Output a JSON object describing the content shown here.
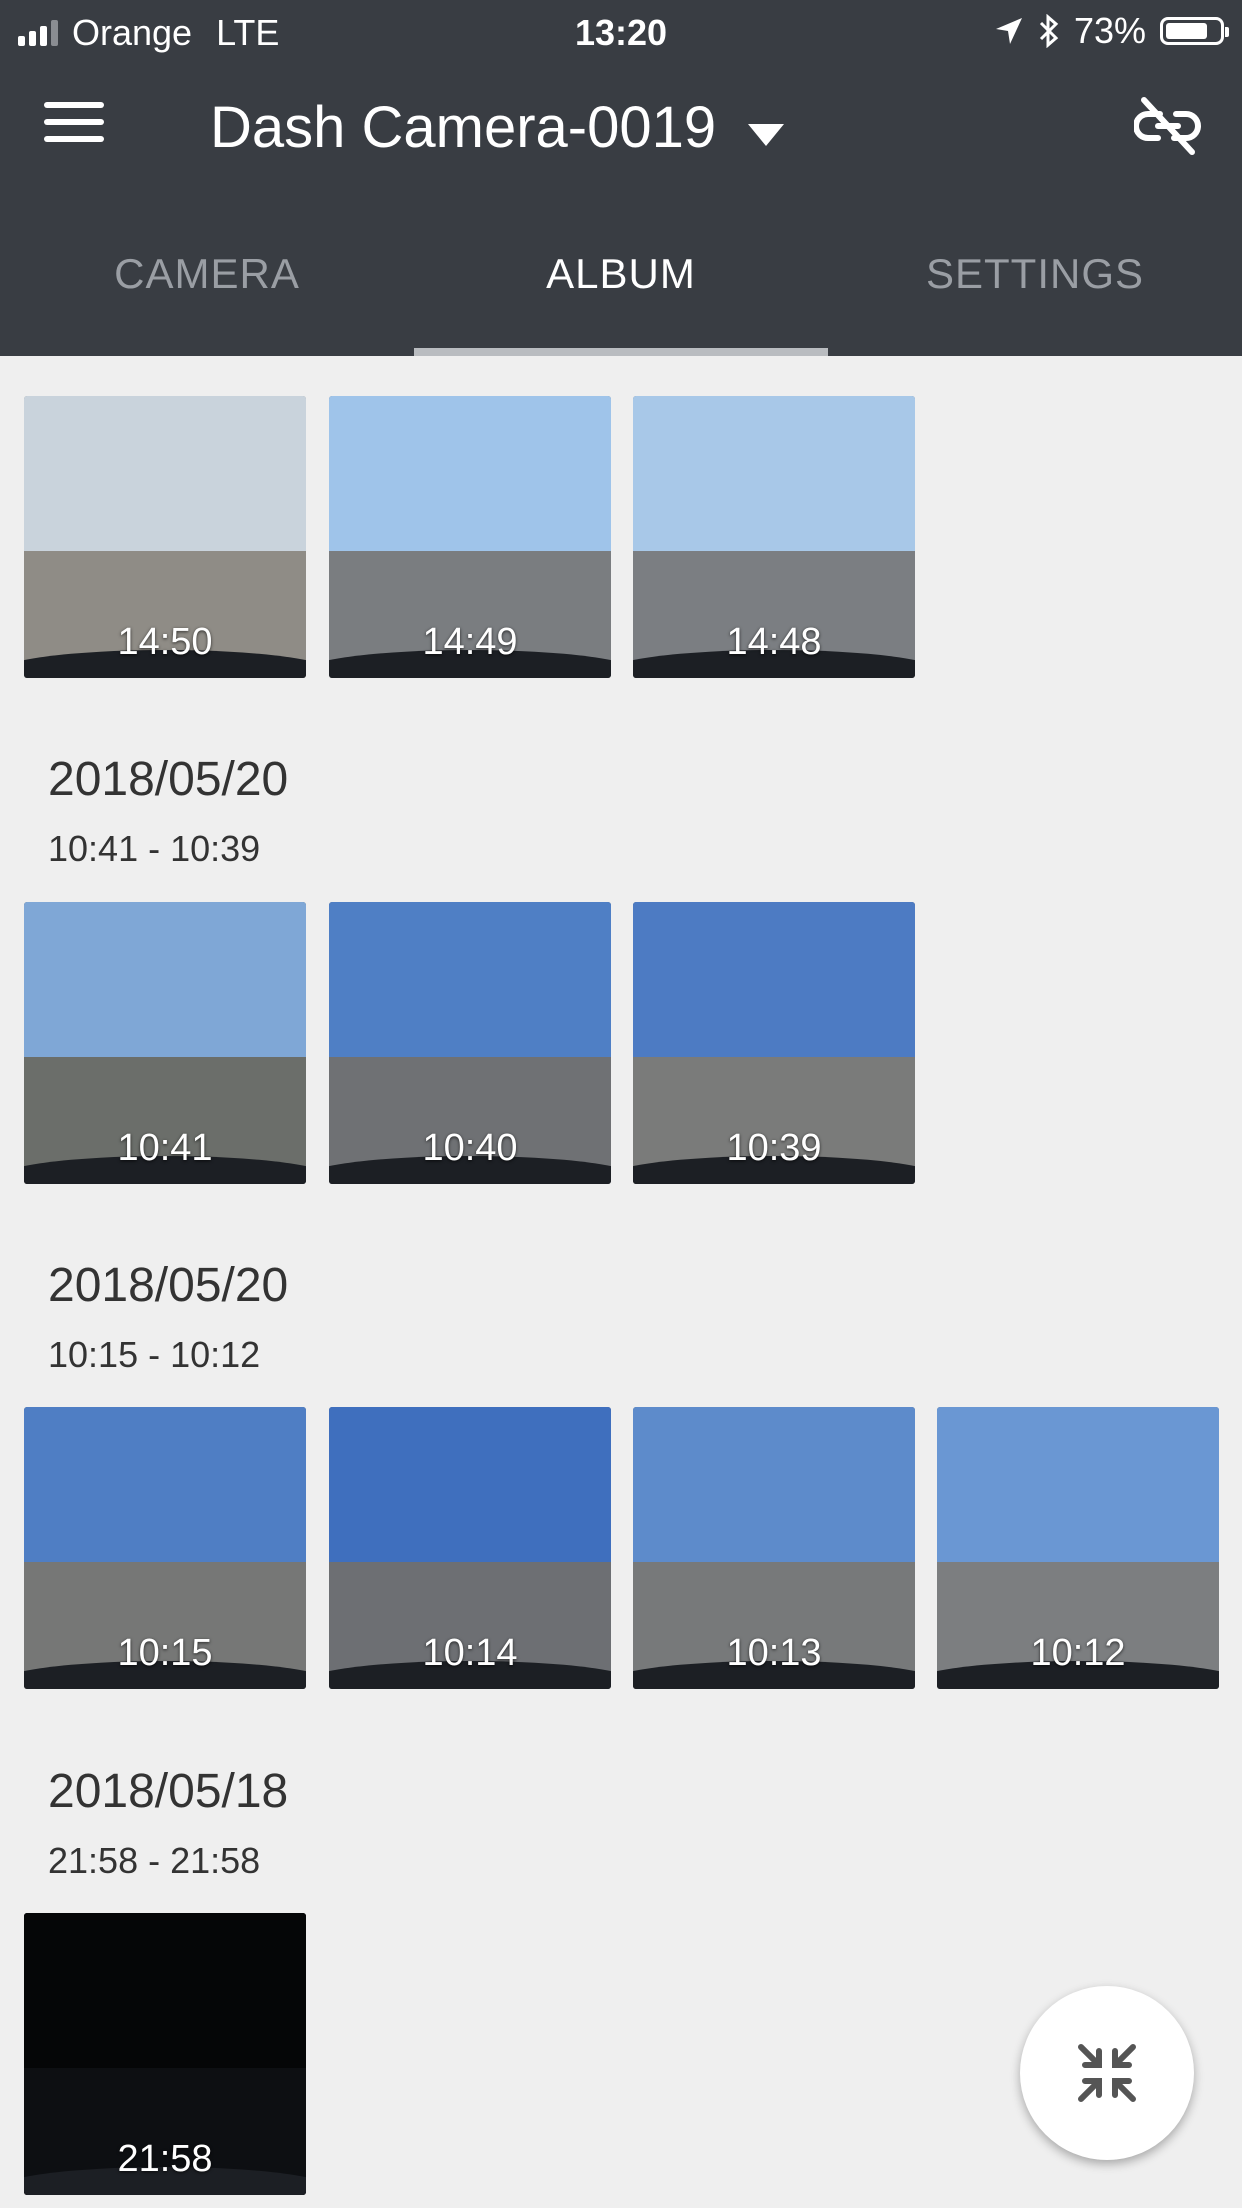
{
  "status_bar": {
    "carrier": "Orange",
    "network": "LTE",
    "time": "13:20",
    "battery": "73%"
  },
  "app_bar": {
    "title": "Dash Camera-0019"
  },
  "tabs": [
    {
      "label": "CAMERA"
    },
    {
      "label": "ALBUM"
    },
    {
      "label": "SETTINGS"
    }
  ],
  "groups": [
    {
      "date": "",
      "range": "",
      "thumbs": [
        {
          "time": "14:50",
          "sky": "#c9d3dc",
          "ground": "#8f8c86"
        },
        {
          "time": "14:49",
          "sky": "#9fc4ea",
          "ground": "#7a7d80"
        },
        {
          "time": "14:48",
          "sky": "#a8c8e8",
          "ground": "#7b7e82"
        }
      ]
    },
    {
      "date": "2018/05/20",
      "range": "10:41 - 10:39",
      "thumbs": [
        {
          "time": "10:41",
          "sky": "#7fa7d6",
          "ground": "#6b6e6a"
        },
        {
          "time": "10:40",
          "sky": "#4f7fc5",
          "ground": "#6f7174"
        },
        {
          "time": "10:39",
          "sky": "#4d7bc3",
          "ground": "#7a7b7a"
        }
      ]
    },
    {
      "date": "2018/05/20",
      "range": "10:15 - 10:12",
      "thumbs": [
        {
          "time": "10:15",
          "sky": "#4f7ec4",
          "ground": "#767776"
        },
        {
          "time": "10:14",
          "sky": "#3f6fbe",
          "ground": "#6d6f73"
        },
        {
          "time": "10:13",
          "sky": "#5d8bcb",
          "ground": "#77797a"
        },
        {
          "time": "10:12",
          "sky": "#6a97d3",
          "ground": "#7c7e80"
        }
      ]
    },
    {
      "date": "2018/05/18",
      "range": "21:58 - 21:58",
      "thumbs": [
        {
          "time": "21:58",
          "sky": "#050607",
          "ground": "#0d0f12"
        }
      ]
    }
  ]
}
